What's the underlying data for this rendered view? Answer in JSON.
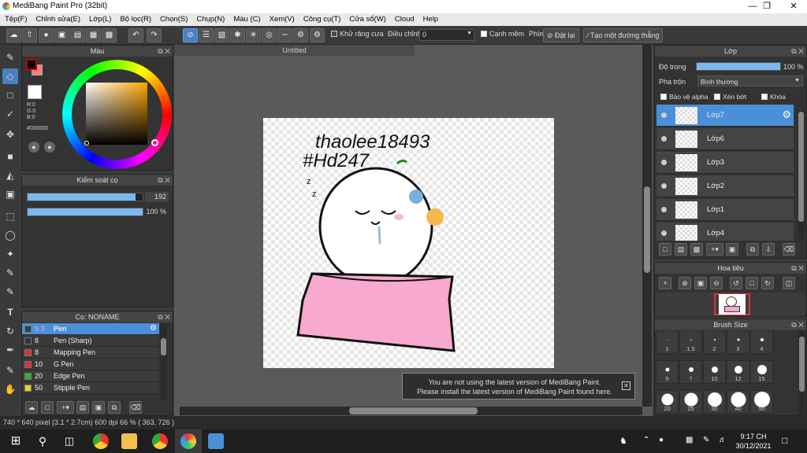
{
  "window": {
    "title": "MediBang Paint Pro (32bit)"
  },
  "menu": [
    "Tệp(F)",
    "Chỉnh sửa(E)",
    "Lớp(L)",
    "Bộ lọc(R)",
    "Chọn(S)",
    "Chụp(N)",
    "Màu (C)",
    "Xem(V)",
    "Công cụ(T)",
    "Cửa sổ(W)",
    "Cloud",
    "Help"
  ],
  "toolbar": {
    "antialias_label": "Khử răng cưa",
    "adjust_label": "Điều chỉnh",
    "adjust_value": "0",
    "edge_label": "Cạnh mềm",
    "keys_label": "Phím",
    "reset_label": "Đặt lại",
    "line_label": "Tạo một đường thẳng"
  },
  "color_panel": {
    "title": "Màu",
    "r": "R:0",
    "g": "G:0",
    "b": "B:0",
    "hex": "#000000",
    "fg": "#000000",
    "bg": "#f08080"
  },
  "brush_control": {
    "title": "Kiểm soát cọ",
    "size": "192",
    "opacity": "100 %",
    "size_frac": 0.94,
    "opacity_frac": 1.0
  },
  "brush_panel": {
    "title": "Cọ: NONAME",
    "items": [
      {
        "size": "9.3",
        "name": "Pen",
        "color": "#3a3a3a"
      },
      {
        "size": "8",
        "name": "Pen (Sharp)",
        "color": "#333333"
      },
      {
        "size": "8",
        "name": "Mapping Pen",
        "color": "#e03030"
      },
      {
        "size": "10",
        "name": "G Pen",
        "color": "#e03030"
      },
      {
        "size": "20",
        "name": "Edge Pen",
        "color": "#30b030"
      },
      {
        "size": "50",
        "name": "Stipple Pen",
        "color": "#e8d020"
      }
    ]
  },
  "document": {
    "tab": "Untitled",
    "text1": "thaolee18493",
    "text2": "#Hd247"
  },
  "notification": {
    "line1": "You are not using the latest version of MediBang Paint.",
    "line2": "Please install the latest version of MediBang Paint found here."
  },
  "status": {
    "text": "740 * 640 pixel   (3.1 * 2.7cm)   600 dpi   66 %   ( 363, 726 )"
  },
  "layer_panel": {
    "title": "Lớp",
    "opacity_label": "Độ trong",
    "opacity_value": "100 %",
    "blend_label": "Pha trộn",
    "blend_value": "Bình thường",
    "protect_alpha": "Bảo vệ alpha",
    "clipping": "Xén bớt",
    "lock": "Khóa",
    "layers": [
      "Lớp7",
      "Lớp6",
      "Lớp3",
      "Lớp2",
      "Lớp1",
      "Lớp4"
    ]
  },
  "navigator": {
    "title": "Hoa tiêu"
  },
  "brush_size": {
    "title": "Brush Size",
    "sizes": [
      "1",
      "1.5",
      "2",
      "3",
      "4",
      "5",
      "7",
      "10",
      "12",
      "15",
      "20",
      "25",
      "30",
      "40",
      "50"
    ]
  },
  "taskbar": {
    "time": "9:17 CH",
    "date": "30/12/2021"
  }
}
